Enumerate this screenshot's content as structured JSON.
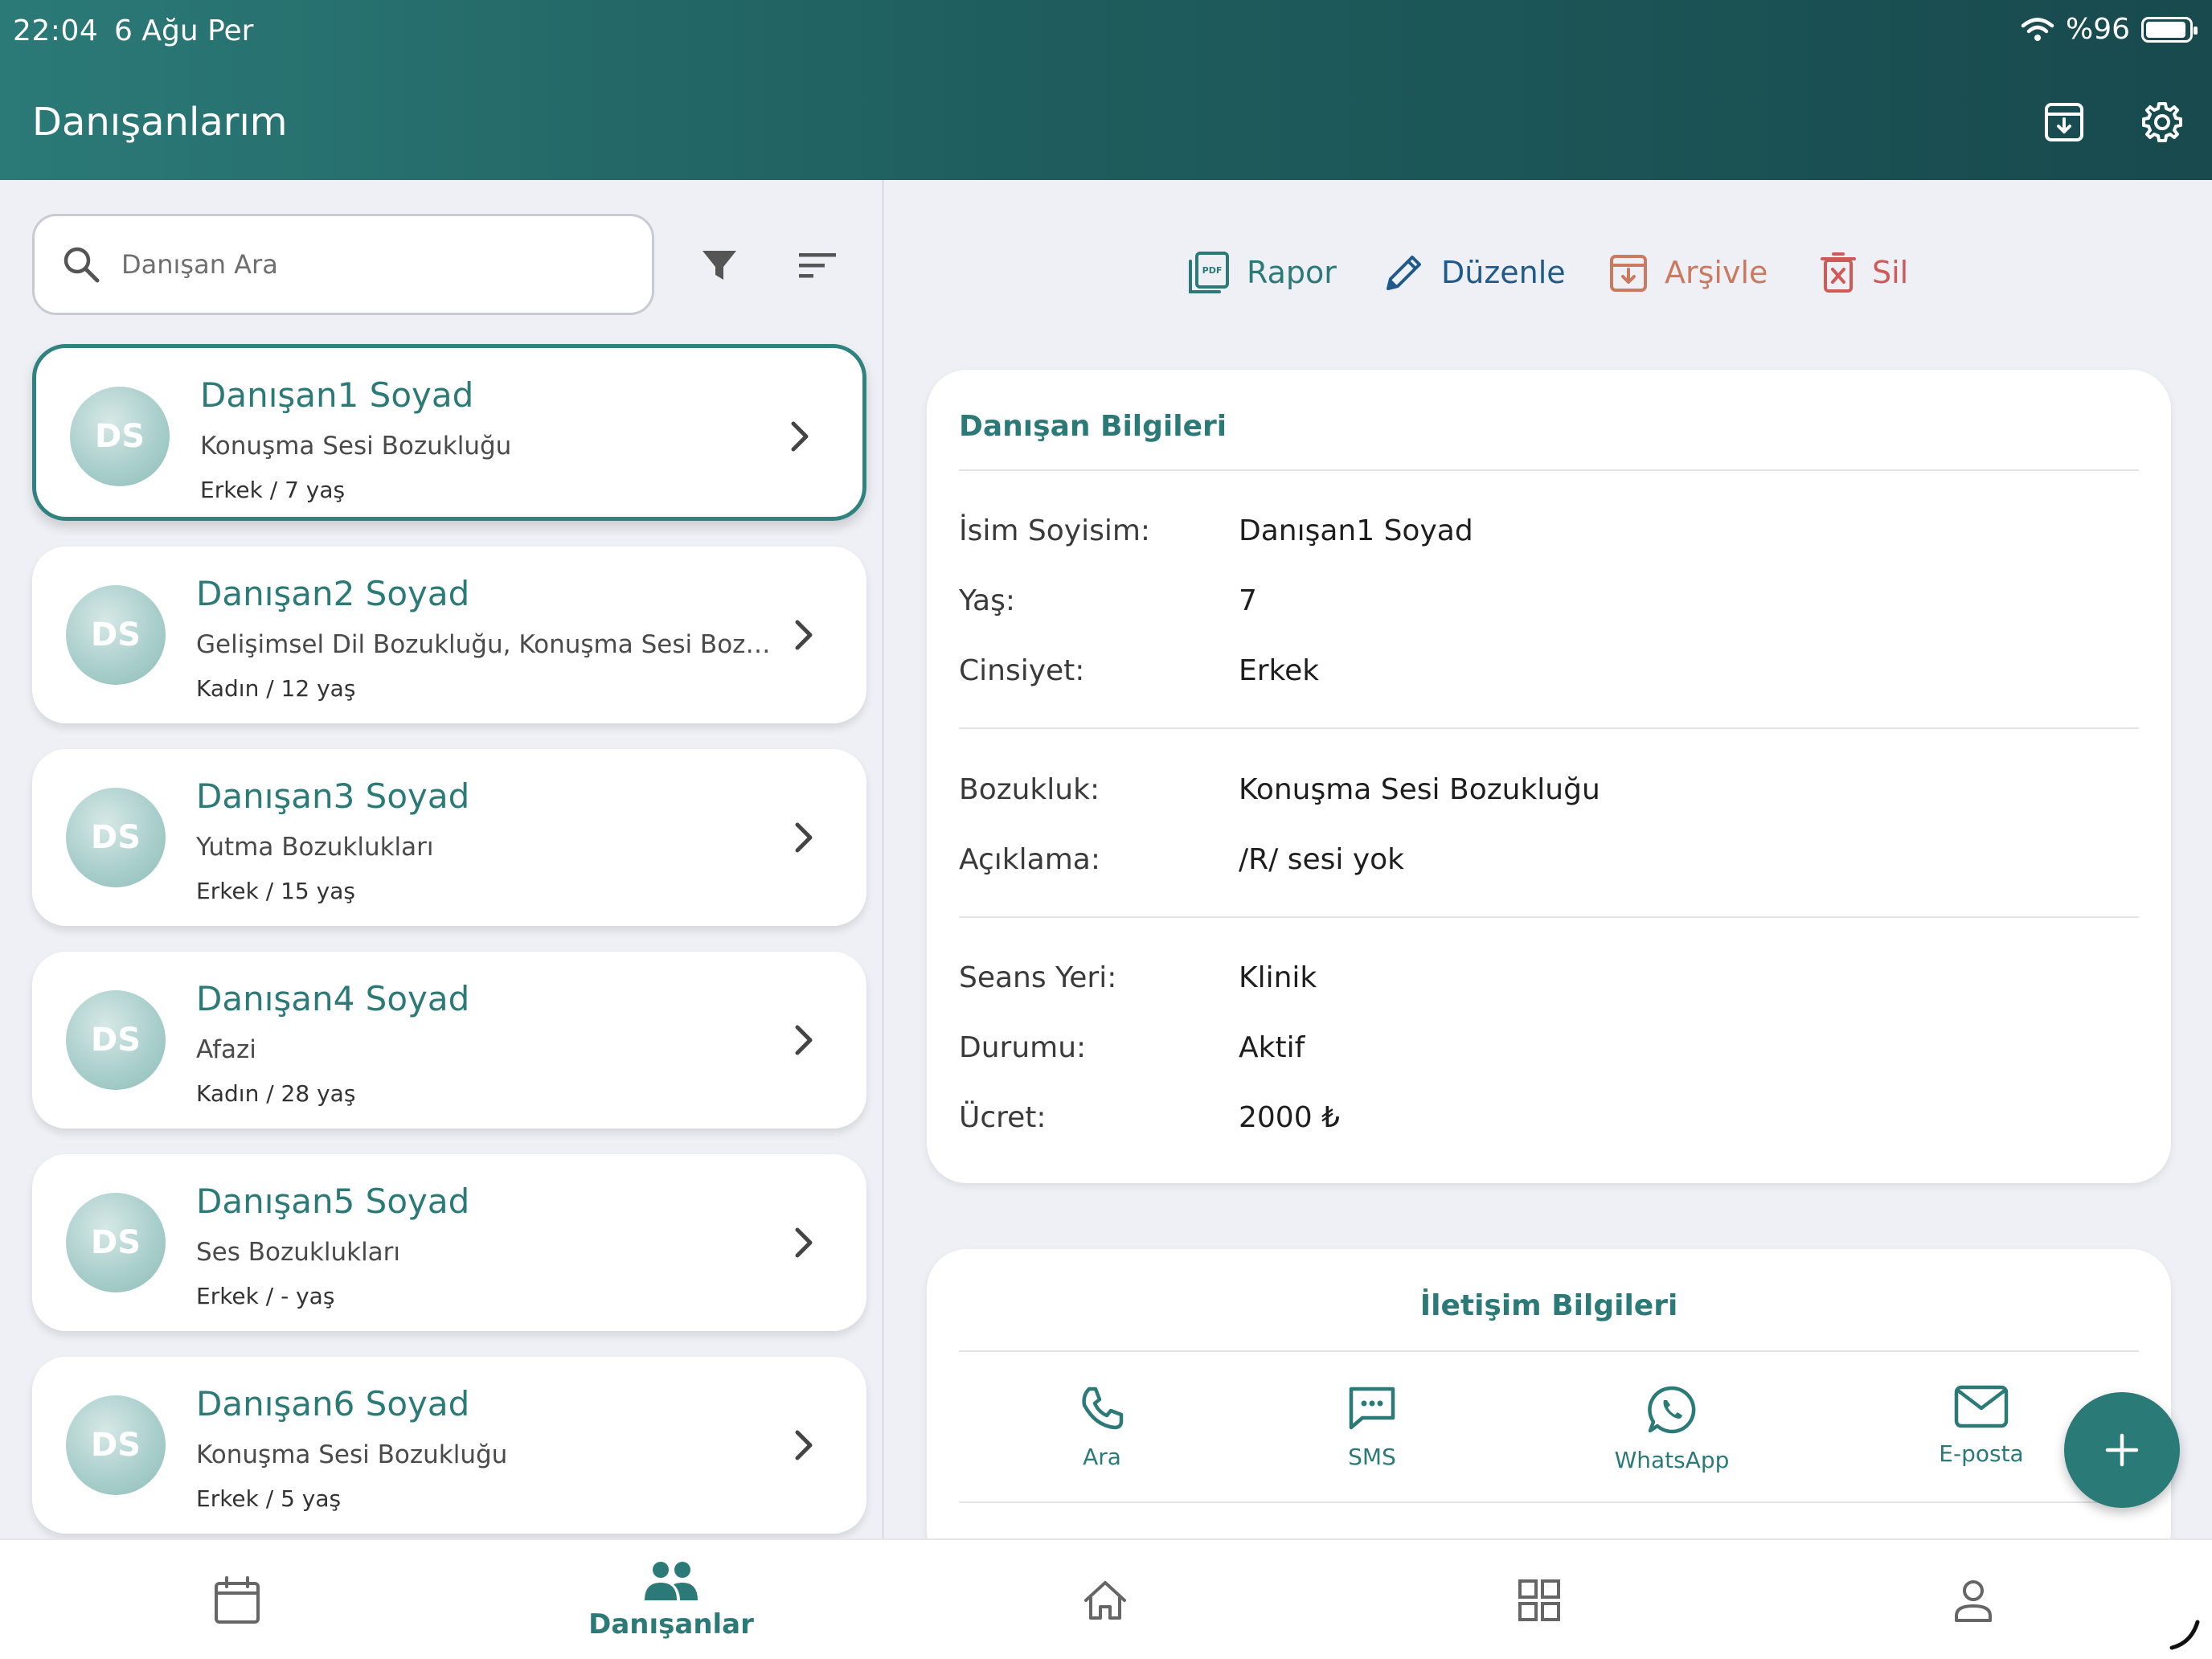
{
  "status_bar": {
    "time": "22:04",
    "date": "6 Ağu Per",
    "battery": "%96"
  },
  "header": {
    "title": "Danışanlarım"
  },
  "search": {
    "placeholder": "Danışan Ara"
  },
  "clients": [
    {
      "initials": "DS",
      "name": "Danışan1 Soyad",
      "disorder": "Konuşma Sesi Bozukluğu",
      "meta": "Erkek / 7 yaş",
      "selected": true
    },
    {
      "initials": "DS",
      "name": "Danışan2 Soyad",
      "disorder": "Gelişimsel Dil Bozukluğu, Konuşma Sesi Bozuklu...",
      "meta": "Kadın / 12 yaş",
      "selected": false
    },
    {
      "initials": "DS",
      "name": "Danışan3 Soyad",
      "disorder": "Yutma Bozuklukları",
      "meta": "Erkek / 15 yaş",
      "selected": false
    },
    {
      "initials": "DS",
      "name": "Danışan4 Soyad",
      "disorder": "Afazi",
      "meta": "Kadın / 28 yaş",
      "selected": false
    },
    {
      "initials": "DS",
      "name": "Danışan5 Soyad",
      "disorder": "Ses Bozuklukları",
      "meta": "Erkek / - yaş",
      "selected": false
    },
    {
      "initials": "DS",
      "name": "Danışan6 Soyad",
      "disorder": "Konuşma Sesi Bozukluğu",
      "meta": "Erkek / 5 yaş",
      "selected": false
    }
  ],
  "actions": {
    "report": "Rapor",
    "edit": "Düzenle",
    "archive": "Arşivle",
    "delete": "Sil"
  },
  "info": {
    "title": "Danışan Bilgileri",
    "name_label": "İsim Soyisim:",
    "name_value": "Danışan1 Soyad",
    "age_label": "Yaş:",
    "age_value": "7",
    "gender_label": "Cinsiyet:",
    "gender_value": "Erkek",
    "disorder_label": "Bozukluk:",
    "disorder_value": "Konuşma Sesi Bozukluğu",
    "desc_label": "Açıklama:",
    "desc_value": "/R/ sesi yok",
    "place_label": "Seans Yeri:",
    "place_value": "Klinik",
    "status_label": "Durumu:",
    "status_value": "Aktif",
    "fee_label": "Ücret:",
    "fee_value": "2000 ₺"
  },
  "contact": {
    "title": "İletişim Bilgileri",
    "call": "Ara",
    "sms": "SMS",
    "whatsapp": "WhatsApp",
    "email": "E-posta"
  },
  "nav": {
    "clients": "Danışanlar"
  },
  "colors": {
    "primary": "#2b7a78",
    "edit": "#1f5a8a",
    "archive": "#c97a5f",
    "delete": "#d05a5a"
  }
}
